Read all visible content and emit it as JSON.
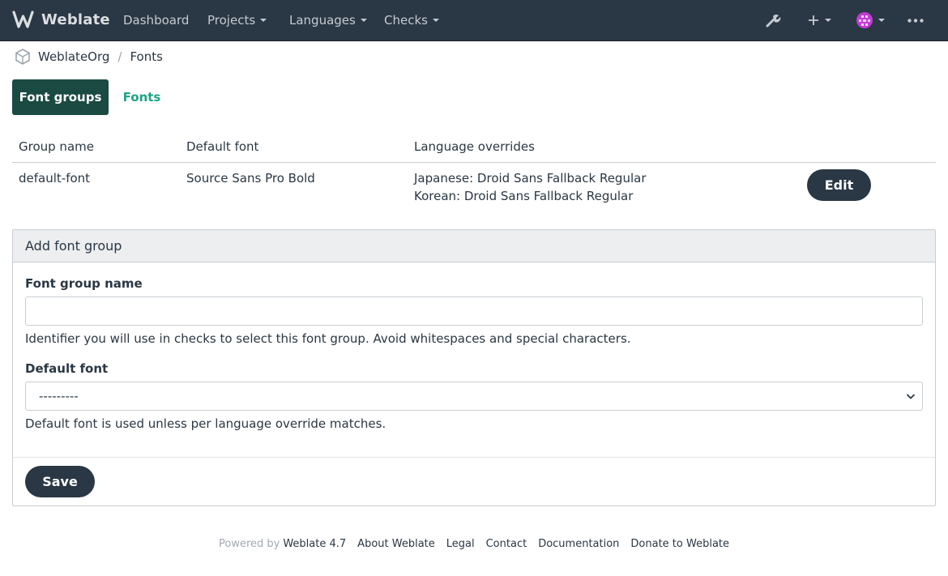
{
  "navbar": {
    "brand": "Weblate",
    "items": [
      "Dashboard",
      "Projects",
      "Languages",
      "Checks"
    ]
  },
  "breadcrumb": {
    "org": "WeblateOrg",
    "page": "Fonts"
  },
  "tabs": {
    "active": "Font groups",
    "other": "Fonts"
  },
  "table": {
    "headers": [
      "Group name",
      "Default font",
      "Language overrides"
    ],
    "row": {
      "name": "default-font",
      "font": "Source Sans Pro Bold",
      "override_1": "Japanese: Droid Sans Fallback Regular",
      "override_2": "Korean: Droid Sans Fallback Regular",
      "edit": "Edit"
    }
  },
  "form": {
    "title": "Add font group",
    "name_label": "Font group name",
    "name_value": "",
    "name_help": "Identifier you will use in checks to select this font group. Avoid whitespaces and special characters.",
    "font_label": "Default font",
    "font_selected": "---------",
    "font_help": "Default font is used unless per language override matches.",
    "save": "Save"
  },
  "footer": {
    "powered_by": "Powered by",
    "version": "Weblate 4.7",
    "links": [
      "About Weblate",
      "Legal",
      "Contact",
      "Documentation",
      "Donate to Weblate"
    ]
  },
  "colors": {
    "navbar": "#2a3744",
    "accent": "#1a4a42",
    "link": "#1fa385"
  }
}
